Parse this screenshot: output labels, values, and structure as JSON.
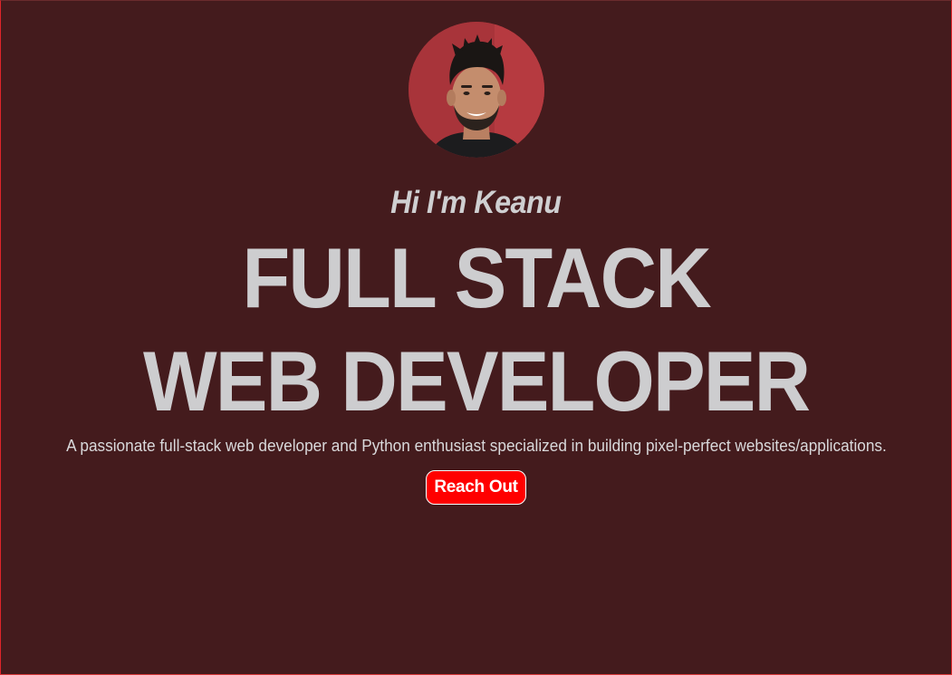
{
  "hero": {
    "avatar_alt": "profile photo",
    "greeting": "Hi I'm Keanu",
    "title_line1": "FULL STACK",
    "title_line2": "WEB DEVELOPER",
    "tagline": "A passionate full-stack web developer and Python enthusiast specialized in building pixel-perfect websites/applications.",
    "cta_label": "Reach Out"
  },
  "colors": {
    "background": "#441b1d",
    "heading_text": "#cdcdcf",
    "accent": "#ff0000",
    "border": "#e0252a"
  }
}
